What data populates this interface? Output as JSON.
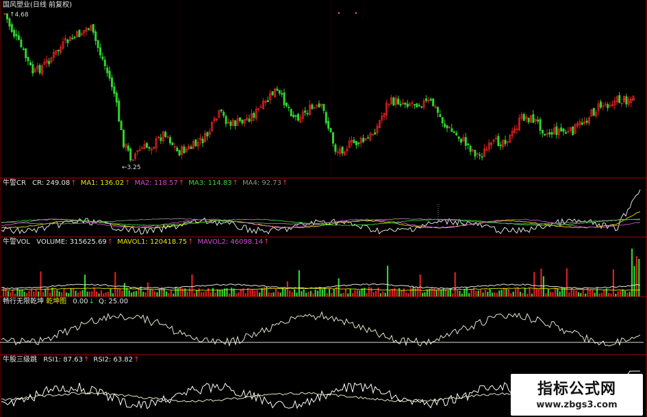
{
  "main": {
    "title": "国风塑业(日线 前复权)",
    "high_label": "4.68",
    "low_label": "3.25",
    "price_max": 4.75,
    "price_min": 3.15
  },
  "cr": {
    "name": "牛警CR",
    "fields": [
      {
        "label": "CR: 249.08",
        "color": "#e6e6e6",
        "arrow": true
      },
      {
        "label": "MA1: 136.02",
        "color": "#e8e800",
        "arrow": true
      },
      {
        "label": "MA2: 118.57",
        "color": "#d24bd2",
        "arrow": true
      },
      {
        "label": "MA3: 114.83",
        "color": "#34d834",
        "arrow": true
      },
      {
        "label": "MA4: 92.73",
        "color": "#8c8c8c",
        "arrow": true
      }
    ]
  },
  "vol": {
    "name": "牛警VOL",
    "fields": [
      {
        "label": "VOLUME: 315625.69",
        "color": "#e6e6e6",
        "arrow": true
      },
      {
        "label": "MAVOL1: 120418.75",
        "color": "#e8e800",
        "arrow": true
      },
      {
        "label": "MAVOL2: 46098.14",
        "color": "#d24bd2",
        "arrow": true
      }
    ]
  },
  "cx": {
    "name": "畅行无限乾坤",
    "sub": "乾坤图",
    "fields": [
      {
        "label": "0.00",
        "color": "#e6e6e6",
        "arrow": false,
        "down": true
      },
      {
        "label": "Q: 25.00",
        "color": "#e6e6e6",
        "arrow": false
      }
    ]
  },
  "rsi": {
    "name": "牛股三级跳",
    "fields": [
      {
        "label": "RSI1: 87.63",
        "color": "#e6e6e6",
        "arrow": true
      },
      {
        "label": "RSI2: 63.82",
        "color": "#e6e6e6",
        "arrow": true
      }
    ]
  },
  "watermark": {
    "title": "指标公式网",
    "url": "www.zbgs3.com"
  },
  "colors": {
    "up": "#e02020",
    "down": "#2fd52f",
    "grid": "#7a0000",
    "divider": "#b00000",
    "dot_grid": "#5a0000"
  }
}
